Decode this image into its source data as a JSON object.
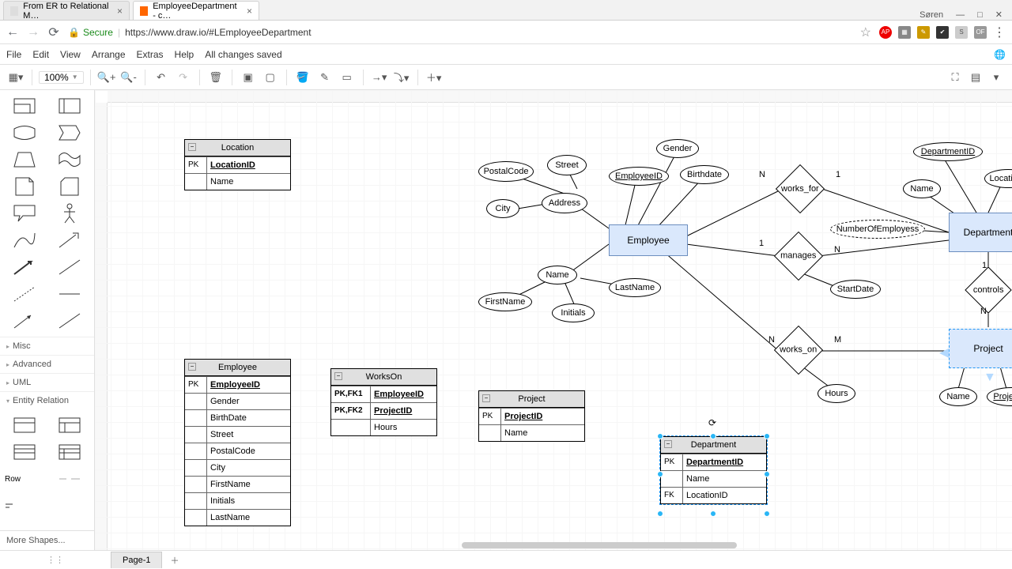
{
  "browser": {
    "tabs": [
      {
        "title": "From ER to Relational M…",
        "active": false
      },
      {
        "title": "EmployeeDepartment - c…",
        "active": true
      }
    ],
    "user": "Søren",
    "secure_label": "Secure",
    "url": "https://www.draw.io/#LEmployeeDepartment"
  },
  "menu": {
    "items": [
      "File",
      "Edit",
      "View",
      "Arrange",
      "Extras",
      "Help"
    ],
    "status": "All changes saved"
  },
  "toolbar": {
    "zoom": "100%"
  },
  "sidebar": {
    "sections": [
      "Misc",
      "Advanced",
      "UML",
      "Entity Relation"
    ],
    "row_label": "Row",
    "more": "More Shapes..."
  },
  "er": {
    "entities": {
      "employee": "Employee",
      "department": "Department",
      "project": "Project"
    },
    "attributes": {
      "postalcode": "PostalCode",
      "street": "Street",
      "city": "City",
      "address": "Address",
      "employeeid": "EmployeeID",
      "gender": "Gender",
      "birthdate": "Birthdate",
      "name_emp": "Name",
      "firstname": "FirstName",
      "lastname": "LastName",
      "initials": "Initials",
      "departmentid": "DepartmentID",
      "locations": "Locations",
      "name_dep": "Name",
      "numemployees": "NumberOfEmployess",
      "startdate": "StartDate",
      "hours": "Hours",
      "name_proj": "Name",
      "projectid": "ProjectID"
    },
    "relationships": {
      "works_for": "works_for",
      "manages": "manages",
      "works_on": "works_on",
      "controls": "controls"
    },
    "cardinalities": {
      "wf_n": "N",
      "wf_1": "1",
      "mg_1": "1",
      "mg_n": "N",
      "wo_n": "N",
      "wo_m": "M",
      "ct_1": "1",
      "ct_n": "N"
    }
  },
  "rel": {
    "location": {
      "title": "Location",
      "rows": [
        {
          "key": "PK",
          "val": "LocationID",
          "pk": true
        },
        {
          "key": "",
          "val": "Name"
        }
      ]
    },
    "employee": {
      "title": "Employee",
      "rows": [
        {
          "key": "PK",
          "val": "EmployeeID",
          "pk": true
        },
        {
          "key": "",
          "val": "Gender"
        },
        {
          "key": "",
          "val": "BirthDate"
        },
        {
          "key": "",
          "val": "Street"
        },
        {
          "key": "",
          "val": "PostalCode"
        },
        {
          "key": "",
          "val": "City"
        },
        {
          "key": "",
          "val": "FirstName"
        },
        {
          "key": "",
          "val": "Initials"
        },
        {
          "key": "",
          "val": "LastName"
        }
      ]
    },
    "workson": {
      "title": "WorksOn",
      "rows": [
        {
          "key": "PK,FK1",
          "val": "EmployeeID",
          "pk": true
        },
        {
          "key": "PK,FK2",
          "val": "ProjectID",
          "pk": true
        },
        {
          "key": "",
          "val": "Hours"
        }
      ]
    },
    "project": {
      "title": "Project",
      "rows": [
        {
          "key": "PK",
          "val": "ProjectID",
          "pk": true
        },
        {
          "key": "",
          "val": "Name"
        }
      ]
    },
    "department": {
      "title": "Department",
      "rows": [
        {
          "key": "PK",
          "val": "DepartmentID",
          "pk": true
        },
        {
          "key": "",
          "val": "Name"
        },
        {
          "key": "FK",
          "val": "LocationID"
        }
      ]
    }
  },
  "footer": {
    "page": "Page-1"
  }
}
